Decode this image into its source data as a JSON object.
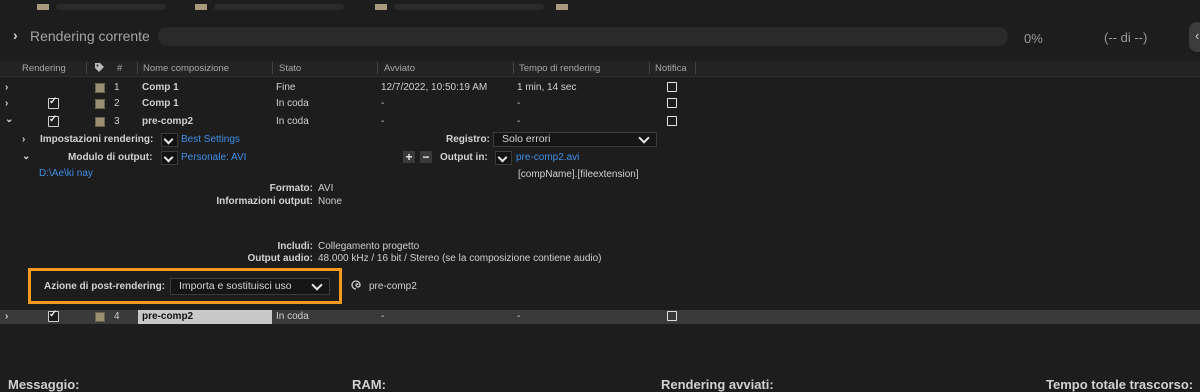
{
  "current": {
    "label": "Rendering corrente",
    "percent": "0%",
    "count": "(-- di --)",
    "progress": 0
  },
  "header": {
    "rendering": "Rendering",
    "num": "#",
    "comp": "Nome composizione",
    "status": "Stato",
    "started": "Avviato",
    "time": "Tempo di rendering",
    "notify": "Notifica"
  },
  "rows": [
    {
      "num": "1",
      "comp": "Comp 1",
      "status": "Fine",
      "started": "12/7/2022, 10:50:19 AM",
      "time": "1 min, 14 sec"
    },
    {
      "num": "2",
      "comp": "Comp 1",
      "status": "In coda",
      "started": "-",
      "time": "-"
    },
    {
      "num": "3",
      "comp": "pre-comp2",
      "status": "In coda",
      "started": "-",
      "time": "-"
    },
    {
      "num": "4",
      "comp": "pre-comp2",
      "status": "In coda",
      "started": "-",
      "time": "-"
    }
  ],
  "details": {
    "render_settings_label": "Impostazioni rendering:",
    "render_settings_value": "Best Settings",
    "log_label": "Registro:",
    "log_value": "Solo errori",
    "output_module_label": "Modulo di output:",
    "output_module_value": "Personale: AVI",
    "output_to_label": "Output in:",
    "output_to_value": "pre-comp2.avi",
    "output_path": "D:\\Ae\\ki nay",
    "output_template": "[compName].[fileextension]",
    "format_label": "Formato:",
    "format_value": "AVI",
    "output_info_label": "Informazioni output:",
    "output_info_value": "None",
    "include_label": "Includi:",
    "include_value": "Collegamento progetto",
    "audio_label": "Output audio:",
    "audio_value": "48.000 kHz / 16 bit / Stereo (se la composizione contiene audio)",
    "post_label": "Azione di post-rendering:",
    "post_value": "Importa e sostituisci uso",
    "post_target": "pre-comp2"
  },
  "footer": {
    "message": "Messaggio:",
    "ram": "RAM:",
    "started": "Rendering avviati:",
    "elapsed": "Tempo totale trascorso:"
  },
  "colors": {
    "accent_link": "#3f8ee8",
    "highlight": "#f39a1f",
    "label_swatch": "#9d8f72"
  }
}
